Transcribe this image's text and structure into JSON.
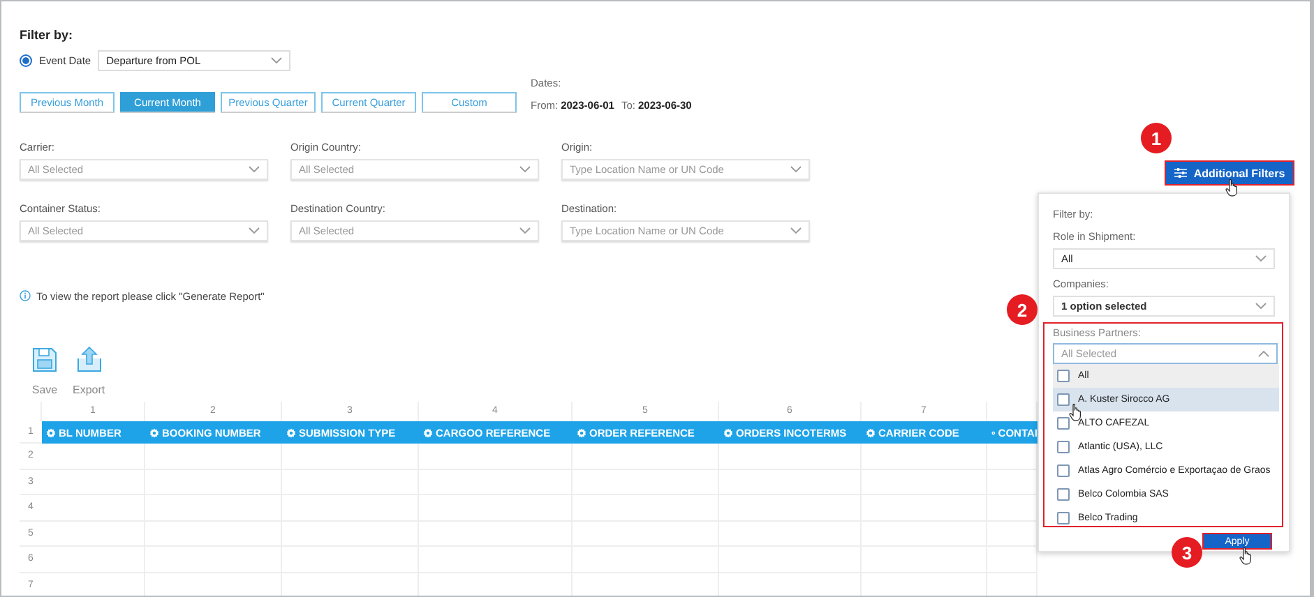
{
  "filter_section": {
    "title": "Filter by:",
    "event_date": {
      "label": "Event Date",
      "selected": true
    },
    "event_select": {
      "value": "Departure from POL"
    },
    "ranges": [
      {
        "label": "Previous Month",
        "selected": false
      },
      {
        "label": "Current Month",
        "selected": true
      },
      {
        "label": "Previous Quarter",
        "selected": false
      },
      {
        "label": "Current Quarter",
        "selected": false
      },
      {
        "label": "Custom",
        "selected": false
      }
    ],
    "dates": {
      "label": "Dates:",
      "from_label": "From:",
      "from": "2023-06-01",
      "to_label": "To:",
      "to": "2023-06-30"
    },
    "filters": [
      {
        "label": "Carrier:",
        "placeholder": "All Selected"
      },
      {
        "label": "Origin Country:",
        "placeholder": "All Selected"
      },
      {
        "label": "Origin:",
        "placeholder": "Type Location Name or UN Code"
      },
      {
        "label": "Container Status:",
        "placeholder": "All Selected"
      },
      {
        "label": "Destination Country:",
        "placeholder": "All Selected"
      },
      {
        "label": "Destination:",
        "placeholder": "Type Location Name or UN Code"
      }
    ],
    "additional_filters_button": "Additional Filters",
    "info": "To view the report please click \"Generate Report\""
  },
  "toolbar": [
    {
      "kind": "save",
      "label": "Save"
    },
    {
      "kind": "export",
      "label": "Export"
    }
  ],
  "grid": {
    "column_numbers": [
      "1",
      "2",
      "3",
      "4",
      "5",
      "6",
      "7"
    ],
    "columns": [
      "BL NUMBER",
      "BOOKING NUMBER",
      "SUBMISSION TYPE",
      "CARGOO REFERENCE",
      "ORDER REFERENCE",
      "ORDERS INCOTERMS",
      "CARRIER CODE",
      "CONTAI"
    ],
    "row_numbers": [
      "1",
      "2",
      "3",
      "4",
      "5",
      "6",
      "7"
    ]
  },
  "additional_filters_panel": {
    "title": "Filter by:",
    "role_label": "Role in Shipment:",
    "role_value": "All",
    "companies_label": "Companies:",
    "companies_value": "1 option selected",
    "partners_label": "Business Partners:",
    "partners_placeholder": "All Selected",
    "partners": [
      {
        "kind": "all",
        "label": "All",
        "checked": false,
        "hovered": false
      },
      {
        "kind": "partner",
        "label": "A. Kuster Sirocco AG",
        "checked": false,
        "hovered": true
      },
      {
        "kind": "partner",
        "label": "ALTO CAFEZAL",
        "checked": false,
        "hovered": false
      },
      {
        "kind": "partner",
        "label": "Atlantic (USA), LLC",
        "checked": false,
        "hovered": false
      },
      {
        "kind": "partner",
        "label": "Atlas Agro Comércio e Exportaçao de Graos",
        "checked": false,
        "hovered": false
      },
      {
        "kind": "partner",
        "label": "Belco Colombia SAS",
        "checked": false,
        "hovered": false
      },
      {
        "kind": "partner",
        "label": "Belco Trading",
        "checked": false,
        "hovered": false
      }
    ],
    "apply_button": "Apply"
  },
  "steps": [
    "1",
    "2",
    "3"
  ]
}
